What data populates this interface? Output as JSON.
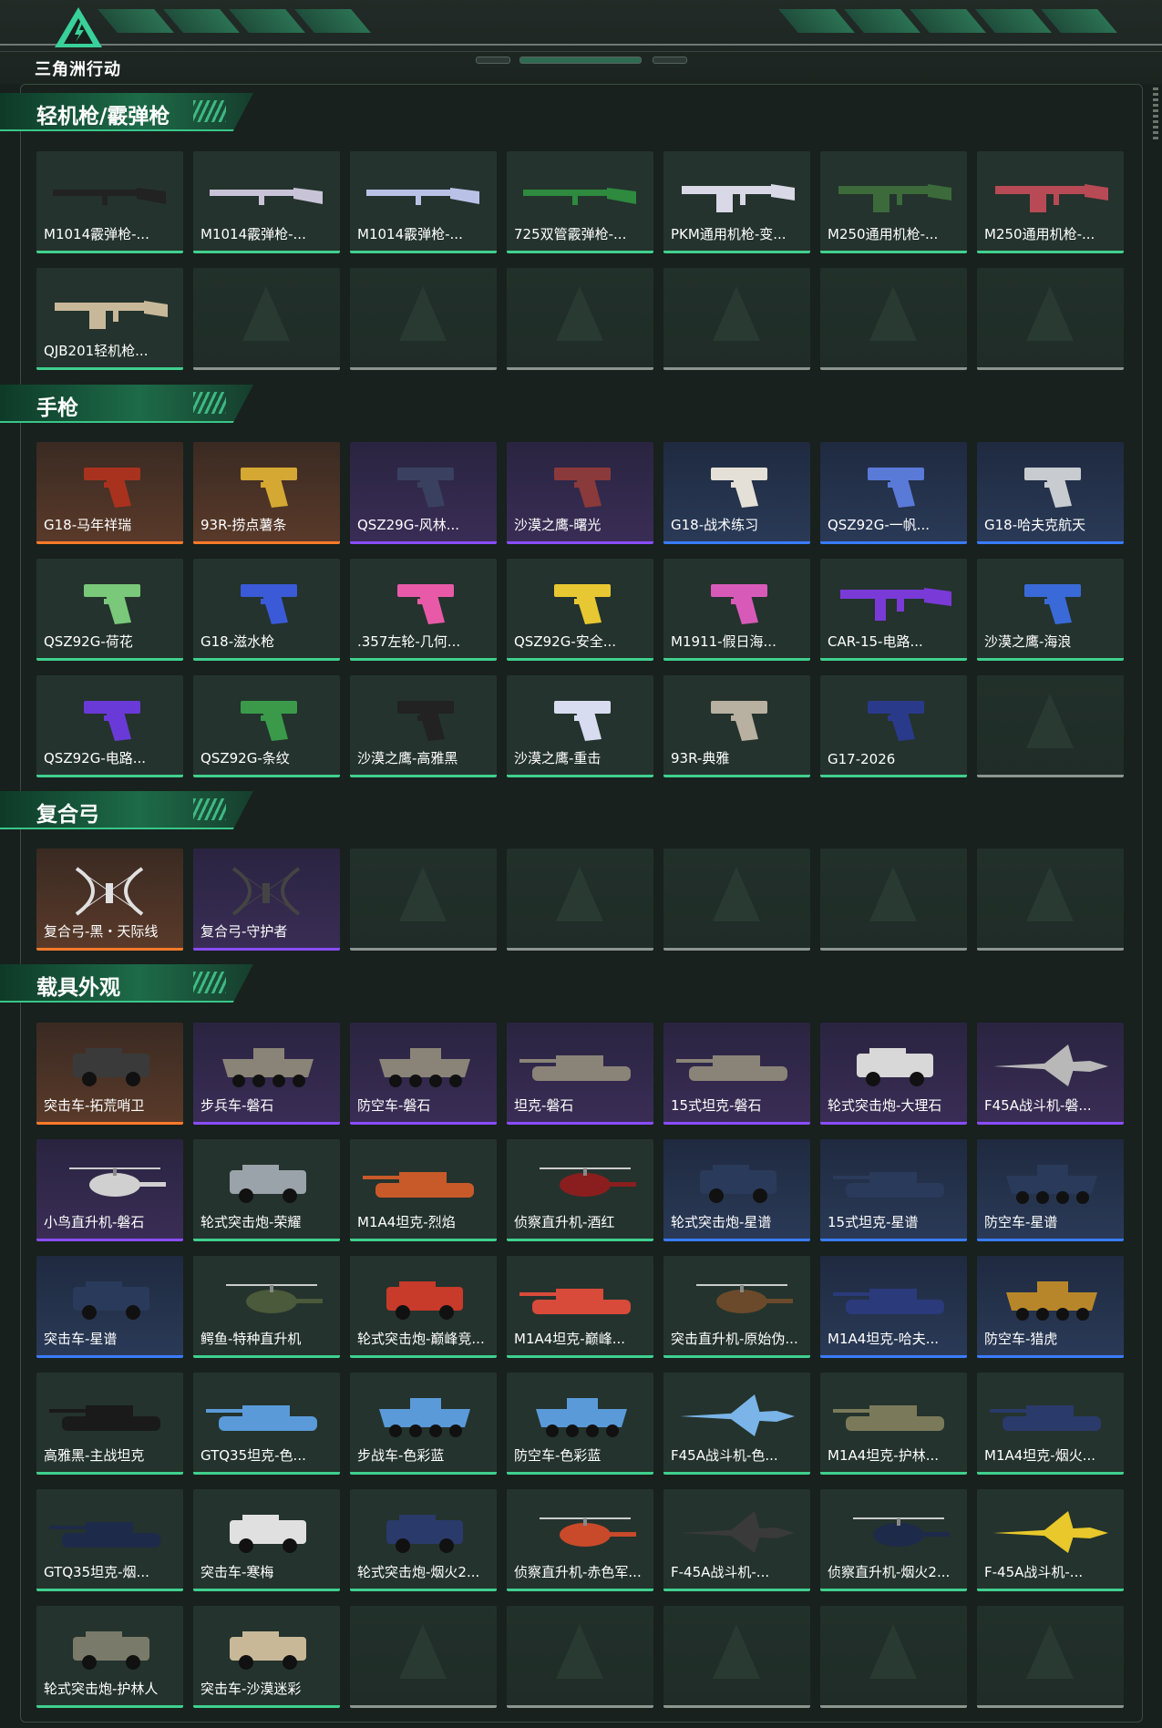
{
  "header": {
    "logo_text": "三角洲行动",
    "logo_icon": "delta-triangle-logo-icon"
  },
  "sections": [
    {
      "title": "轻机枪/霰弹枪",
      "items": [
        {
          "name": "M1014霰弹枪-...",
          "quality": "green",
          "kind": "shotgun",
          "color": "#222222"
        },
        {
          "name": "M1014霰弹枪-...",
          "quality": "green",
          "kind": "shotgun",
          "color": "#c9c3d8"
        },
        {
          "name": "M1014霰弹枪-...",
          "quality": "green",
          "kind": "shotgun",
          "color": "#b9c2e6"
        },
        {
          "name": "725双管霰弹枪-...",
          "quality": "green",
          "kind": "shotgun",
          "color": "#2e8a3e"
        },
        {
          "name": "PKM通用机枪-变...",
          "quality": "green",
          "kind": "mg",
          "color": "#d8d8e6"
        },
        {
          "name": "M250通用机枪-...",
          "quality": "green",
          "kind": "mg",
          "color": "#3c6a3a"
        },
        {
          "name": "M250通用机枪-...",
          "quality": "green",
          "kind": "mg",
          "color": "#b84a55"
        },
        {
          "name": "QJB201轻机枪...",
          "quality": "green",
          "kind": "mg",
          "color": "#c8b89a"
        }
      ],
      "empty_count": 6
    },
    {
      "title": "手枪",
      "items": [
        {
          "name": "G18-马年祥瑞",
          "quality": "orange",
          "kind": "pistol",
          "color": "#a8321e"
        },
        {
          "name": "93R-捞点薯条",
          "quality": "orange",
          "kind": "pistol",
          "color": "#d4a832"
        },
        {
          "name": "QSZ29G-风林...",
          "quality": "purple",
          "kind": "pistol",
          "color": "#3a4060"
        },
        {
          "name": "沙漠之鹰-曙光",
          "quality": "purple",
          "kind": "pistol",
          "color": "#8a3a3a"
        },
        {
          "name": "G18-战术练习",
          "quality": "blue",
          "kind": "pistol",
          "color": "#e4e0d8"
        },
        {
          "name": "QSZ92G-一帆...",
          "quality": "blue",
          "kind": "pistol",
          "color": "#5a7ad8"
        },
        {
          "name": "G18-哈夫克航天",
          "quality": "blue",
          "kind": "pistol",
          "color": "#c8ccd0"
        },
        {
          "name": "QSZ92G-荷花",
          "quality": "green",
          "kind": "pistol",
          "color": "#7ac87a"
        },
        {
          "name": "G18-滋水枪",
          "quality": "green",
          "kind": "pistol",
          "color": "#3a5ad8"
        },
        {
          "name": ".357左轮-几何...",
          "quality": "green",
          "kind": "pistol",
          "color": "#e85aa8"
        },
        {
          "name": "QSZ92G-安全...",
          "quality": "green",
          "kind": "pistol",
          "color": "#e8c832"
        },
        {
          "name": "M1911-假日海...",
          "quality": "green",
          "kind": "pistol",
          "color": "#d85ab8"
        },
        {
          "name": "CAR-15-电路...",
          "quality": "green",
          "kind": "rifle",
          "color": "#7a3ad8"
        },
        {
          "name": "沙漠之鹰-海浪",
          "quality": "green",
          "kind": "pistol",
          "color": "#3a6ad8"
        },
        {
          "name": "QSZ92G-电路...",
          "quality": "green",
          "kind": "pistol",
          "color": "#6a3ad8"
        },
        {
          "name": "QSZ92G-条纹",
          "quality": "green",
          "kind": "pistol",
          "color": "#3a9a4a"
        },
        {
          "name": "沙漠之鹰-高雅黑",
          "quality": "green",
          "kind": "pistol",
          "color": "#222222"
        },
        {
          "name": "沙漠之鹰-重击",
          "quality": "green",
          "kind": "pistol",
          "color": "#d8dcf0"
        },
        {
          "name": "93R-典雅",
          "quality": "green",
          "kind": "pistol",
          "color": "#b8b0a0"
        },
        {
          "name": "G17-2026",
          "quality": "green",
          "kind": "pistol",
          "color": "#2a3a8a"
        }
      ],
      "empty_count": 1
    },
    {
      "title": "复合弓",
      "items": [
        {
          "name": "复合弓-黑・天际线",
          "quality": "orange",
          "kind": "bow",
          "color": "#e0e0e0"
        },
        {
          "name": "复合弓-守护者",
          "quality": "purple",
          "kind": "bow",
          "color": "#444444"
        }
      ],
      "empty_count": 5
    },
    {
      "title": "载具外观",
      "items": [
        {
          "name": "突击车-拓荒哨卫",
          "quality": "orange",
          "kind": "truck",
          "color": "#3a3a3a"
        },
        {
          "name": "步兵车-磐石",
          "quality": "purple",
          "kind": "apc",
          "color": "#8a8478"
        },
        {
          "name": "防空车-磐石",
          "quality": "purple",
          "kind": "apc",
          "color": "#8a8478"
        },
        {
          "name": "坦克-磐石",
          "quality": "purple",
          "kind": "tank",
          "color": "#8a8478"
        },
        {
          "name": "15式坦克-磐石",
          "quality": "purple",
          "kind": "tank",
          "color": "#8a8478"
        },
        {
          "name": "轮式突击炮-大理石",
          "quality": "purple",
          "kind": "truck",
          "color": "#d8d8d8"
        },
        {
          "name": "F45A战斗机-磐...",
          "quality": "purple",
          "kind": "jet",
          "color": "#b8b8b8"
        },
        {
          "name": "小鸟直升机-磐石",
          "quality": "purple",
          "kind": "heli",
          "color": "#d0d0d0"
        },
        {
          "name": "轮式突击炮-荣耀",
          "quality": "green",
          "kind": "truck",
          "color": "#9aa2aa"
        },
        {
          "name": "M1A4坦克-烈焰",
          "quality": "green",
          "kind": "tank",
          "color": "#c85a2a"
        },
        {
          "name": "侦察直升机-酒红",
          "quality": "green",
          "kind": "heli",
          "color": "#8a1e1e"
        },
        {
          "name": "轮式突击炮-星谱",
          "quality": "blue",
          "kind": "truck",
          "color": "#2a3a5a"
        },
        {
          "name": "15式坦克-星谱",
          "quality": "blue",
          "kind": "tank",
          "color": "#2a3a5a"
        },
        {
          "name": "防空车-星谱",
          "quality": "blue",
          "kind": "apc",
          "color": "#2a3a5a"
        },
        {
          "name": "突击车-星谱",
          "quality": "blue",
          "kind": "truck",
          "color": "#2a3a5a"
        },
        {
          "name": "鳄鱼-特种直升机",
          "quality": "green",
          "kind": "heli",
          "color": "#4a5a3a"
        },
        {
          "name": "轮式突击炮-巅峰竞...",
          "quality": "green",
          "kind": "truck",
          "color": "#c83a2a"
        },
        {
          "name": "M1A4坦克-巅峰...",
          "quality": "green",
          "kind": "tank",
          "color": "#d84a3a"
        },
        {
          "name": "突击直升机-原始伪...",
          "quality": "green",
          "kind": "heli",
          "color": "#6a4a2a"
        },
        {
          "name": "M1A4坦克-哈夫...",
          "quality": "blue",
          "kind": "tank",
          "color": "#2a3a7a"
        },
        {
          "name": "防空车-猎虎",
          "quality": "blue",
          "kind": "apc",
          "color": "#b8862a"
        },
        {
          "name": "高雅黑-主战坦克",
          "quality": "green",
          "kind": "tank",
          "color": "#1a1a1a"
        },
        {
          "name": "GTQ35坦克-色...",
          "quality": "green",
          "kind": "tank",
          "color": "#5a9ad8"
        },
        {
          "name": "步战车-色彩蓝",
          "quality": "green",
          "kind": "apc",
          "color": "#5a9ad8"
        },
        {
          "name": "防空车-色彩蓝",
          "quality": "green",
          "kind": "apc",
          "color": "#5a9ad8"
        },
        {
          "name": "F45A战斗机-色...",
          "quality": "green",
          "kind": "jet",
          "color": "#7ab4e8"
        },
        {
          "name": "M1A4坦克-护林...",
          "quality": "green",
          "kind": "tank",
          "color": "#7a7a5a"
        },
        {
          "name": "M1A4坦克-烟火...",
          "quality": "green",
          "kind": "tank",
          "color": "#2a3a6a"
        },
        {
          "name": "GTQ35坦克-烟...",
          "quality": "green",
          "kind": "tank",
          "color": "#1e2a4a"
        },
        {
          "name": "突击车-寒梅",
          "quality": "green",
          "kind": "truck",
          "color": "#e0e0e0"
        },
        {
          "name": "轮式突击炮-烟火2...",
          "quality": "green",
          "kind": "truck",
          "color": "#2a3a6a"
        },
        {
          "name": "侦察直升机-赤色军...",
          "quality": "green",
          "kind": "heli",
          "color": "#c84a2a"
        },
        {
          "name": "F-45A战斗机-...",
          "quality": "green",
          "kind": "jet",
          "color": "#3a3a3a"
        },
        {
          "name": "侦察直升机-烟火2...",
          "quality": "green",
          "kind": "heli",
          "color": "#1e2a4a"
        },
        {
          "name": "F-45A战斗机-...",
          "quality": "green",
          "kind": "jet",
          "color": "#e8c82a"
        },
        {
          "name": "轮式突击炮-护林人",
          "quality": "green",
          "kind": "truck",
          "color": "#7a7a6a"
        },
        {
          "name": "突击车-沙漠迷彩",
          "quality": "green",
          "kind": "truck",
          "color": "#c8b898"
        }
      ],
      "empty_count": 5
    }
  ]
}
